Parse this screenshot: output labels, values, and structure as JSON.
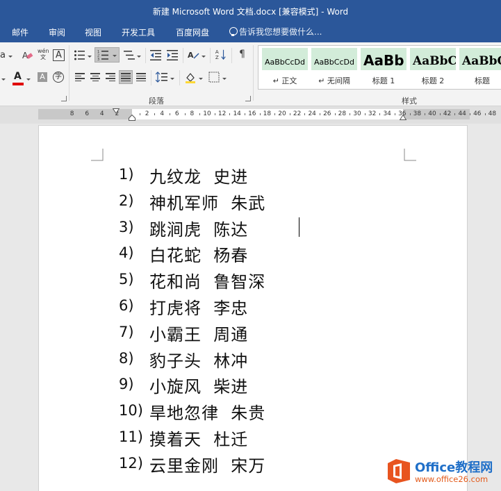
{
  "window": {
    "title": "新建 Microsoft Word 文档.docx [兼容模式] - Word"
  },
  "ribbon_tabs": [
    "邮件",
    "审阅",
    "视图",
    "开发工具",
    "百度网盘"
  ],
  "tell_me": "告诉我您想要做什么...",
  "ribbon": {
    "phonetic_guide": "wén\n文",
    "char_border": "A",
    "font_color": "A",
    "char_shading": "A",
    "enclosed_char": "字",
    "font_partial": "a",
    "paragraph_group": "段落",
    "styles_group": "样式"
  },
  "styles": [
    {
      "preview": "AaBbCcDd",
      "name": "↵ 正文"
    },
    {
      "preview": "AaBbCcDd",
      "name": "↵ 无间隔"
    },
    {
      "preview": "AaBb",
      "name": "标题 1"
    },
    {
      "preview": "AaBbC",
      "name": "标题 2"
    },
    {
      "preview": "AaBbC",
      "name": "标题"
    }
  ],
  "ruler": {
    "left_labels": [
      "8",
      "6",
      "4",
      "2"
    ],
    "right_labels": [
      "2",
      "4",
      "6",
      "8",
      "10",
      "12",
      "14",
      "16",
      "18",
      "20",
      "22",
      "24",
      "26",
      "28",
      "30",
      "32",
      "34",
      "36",
      "38",
      "40",
      "42",
      "44",
      "46",
      "48"
    ]
  },
  "document": {
    "list": [
      {
        "num": "1)",
        "text": "九纹龙  史进"
      },
      {
        "num": "2)",
        "text": "神机军师  朱武"
      },
      {
        "num": "3)",
        "text": "跳涧虎  陈达"
      },
      {
        "num": "4)",
        "text": "白花蛇  杨春"
      },
      {
        "num": "5)",
        "text": "花和尚  鲁智深"
      },
      {
        "num": "6)",
        "text": "打虎将  李忠"
      },
      {
        "num": "7)",
        "text": "小霸王  周通"
      },
      {
        "num": "8)",
        "text": "豹子头  林冲"
      },
      {
        "num": "9)",
        "text": "小旋风  柴进"
      },
      {
        "num": "10)",
        "text": "旱地忽律  朱贵"
      },
      {
        "num": "11)",
        "text": "摸着天  杜迁"
      },
      {
        "num": "12)",
        "text": "云里金刚  宋万"
      }
    ]
  },
  "watermark": {
    "title": "Office教程网",
    "url": "www.office26.com"
  }
}
